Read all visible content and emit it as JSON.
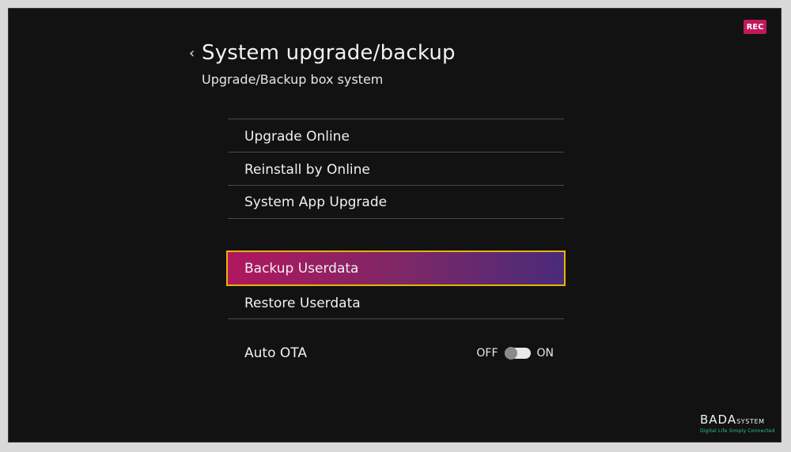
{
  "header": {
    "title": "System upgrade/backup",
    "subtitle": "Upgrade/Backup box system",
    "rec_badge": "REC"
  },
  "menu": {
    "items": [
      {
        "label": "Upgrade Online"
      },
      {
        "label": "Reinstall by Online"
      },
      {
        "label": "System App Upgrade"
      },
      {
        "label": "Backup Userdata",
        "selected": true
      },
      {
        "label": "Restore Userdata"
      }
    ]
  },
  "auto_ota": {
    "label": "Auto OTA",
    "off_label": "OFF",
    "on_label": "ON",
    "state": "off"
  },
  "brand": {
    "name": "BADA",
    "suffix": "SYSTEM",
    "tagline": "Digital Life Simply Connected"
  },
  "colors": {
    "rec_badge": "#c2185b",
    "selection_border": "#e5b400",
    "selection_gradient_start": "#b0175e",
    "selection_gradient_end": "#4a2a7a",
    "tagline": "#28c3a0"
  }
}
